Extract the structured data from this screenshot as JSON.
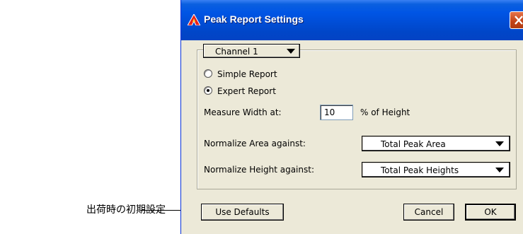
{
  "annotation": {
    "text": "出荷時の初期設定"
  },
  "dialog": {
    "title": "Peak Report Settings",
    "app_icon": "app-logo-icon",
    "close_icon": "close-icon",
    "channel_selector": {
      "value": "Channel 1"
    },
    "report_type": {
      "options": [
        {
          "label": "Simple Report",
          "selected": false
        },
        {
          "label": "Expert Report",
          "selected": true
        }
      ]
    },
    "measure_width": {
      "label": "Measure Width at:",
      "value": "10",
      "suffix": "% of Height"
    },
    "normalize_area": {
      "label": "Normalize Area against:",
      "value": "Total Peak Area"
    },
    "normalize_height": {
      "label": "Normalize Height against:",
      "value": "Total Peak Heights"
    },
    "buttons": {
      "use_defaults": "Use Defaults",
      "cancel": "Cancel",
      "ok": "OK"
    },
    "colors": {
      "titlebar": "#0055e5",
      "face": "#ece9d8",
      "close": "#c24216"
    }
  }
}
